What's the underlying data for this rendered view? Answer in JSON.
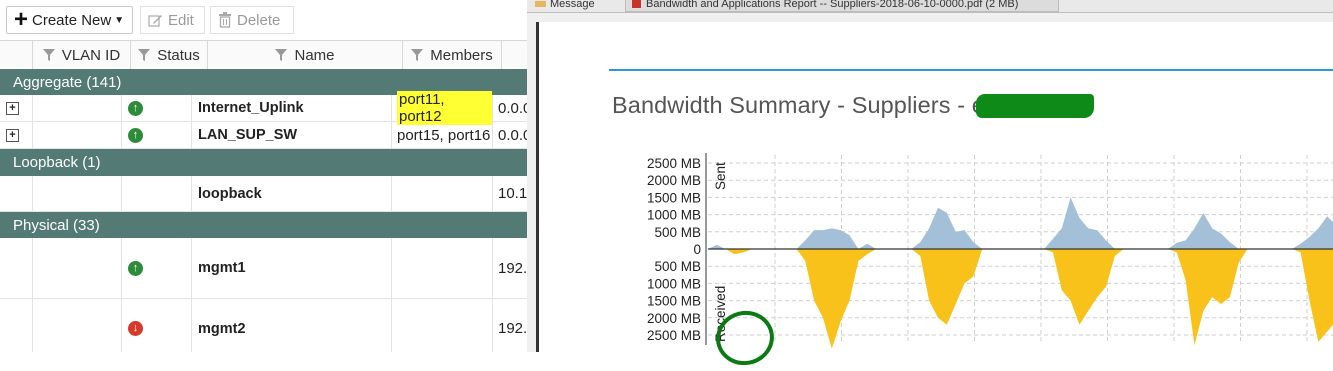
{
  "toolbar": {
    "create_label": "Create New",
    "edit_label": "Edit",
    "delete_label": "Delete"
  },
  "table": {
    "columns": [
      "VLAN ID",
      "Status",
      "Name",
      "Members"
    ],
    "groups": [
      {
        "label": "Aggregate (141)"
      },
      {
        "label": "Loopback (1)"
      },
      {
        "label": "Physical (33)"
      }
    ],
    "rows": [
      {
        "name": "Internet_Uplink",
        "members": "port11, port12",
        "ip": "0.0.0",
        "status": "up",
        "expand": "+",
        "highlight": true
      },
      {
        "name": "LAN_SUP_SW",
        "members": "port15, port16",
        "ip": "0.0.0",
        "status": "up",
        "expand": "+",
        "highlight": false
      },
      {
        "name": "loopback",
        "members": "",
        "ip": "10.1",
        "status": "",
        "expand": "",
        "highlight": false
      },
      {
        "name": "mgmt1",
        "members": "",
        "ip": "192.",
        "status": "up",
        "expand": "",
        "highlight": false
      },
      {
        "name": "mgmt2",
        "members": "",
        "ip": "192.",
        "status": "down",
        "expand": "",
        "highlight": false
      }
    ]
  },
  "viewer": {
    "tab_message": "Message",
    "tab_pdf": "Bandwidth and Applications Report -- Suppliers-2018-06-10-0000.pdf (2 MB)",
    "report_title": "Bandwidth Summary - Suppliers -                   e_WAN"
  },
  "chart_data": {
    "type": "area",
    "title": "",
    "sent_label": "Sent",
    "received_label": "Received",
    "y_ticks_sent": [
      "2500 MB",
      "2000 MB",
      "1500 MB",
      "1000 MB",
      "500 MB"
    ],
    "y_zero": "0",
    "y_ticks_received": [
      "500 MB",
      "1000 MB",
      "1500 MB",
      "2000 MB",
      "2500 MB"
    ],
    "ylim_sent": [
      0,
      2500
    ],
    "ylim_received": [
      0,
      2500
    ],
    "grid": true,
    "colors": {
      "sent": "#a4bfd8",
      "received": "#f8c21a"
    },
    "sent": [
      0,
      120,
      0,
      0,
      0,
      0,
      0,
      0,
      0,
      0,
      0,
      250,
      550,
      550,
      600,
      550,
      400,
      0,
      150,
      0,
      0,
      0,
      0,
      0,
      200,
      600,
      1200,
      1050,
      500,
      550,
      200,
      0,
      0,
      0,
      0,
      0,
      0,
      0,
      0,
      300,
      600,
      1500,
      900,
      600,
      550,
      250,
      0,
      0,
      0,
      0,
      0,
      0,
      0,
      180,
      250,
      600,
      1050,
      600,
      450,
      200,
      0,
      0,
      0,
      0,
      0,
      0,
      0,
      150,
      350,
      600,
      950,
      700
    ],
    "received": [
      0,
      0,
      0,
      150,
      100,
      0,
      0,
      0,
      0,
      0,
      0,
      350,
      1500,
      2000,
      2900,
      2100,
      1500,
      350,
      150,
      0,
      0,
      0,
      0,
      0,
      200,
      1500,
      2000,
      2200,
      1600,
      1000,
      800,
      0,
      0,
      0,
      0,
      0,
      0,
      0,
      0,
      100,
      1200,
      1500,
      2200,
      1800,
      1400,
      1100,
      200,
      0,
      0,
      0,
      0,
      0,
      0,
      100,
      900,
      2800,
      1800,
      1400,
      1600,
      1400,
      400,
      0,
      0,
      0,
      0,
      0,
      0,
      100,
      1500,
      2700,
      2400,
      2100
    ]
  }
}
